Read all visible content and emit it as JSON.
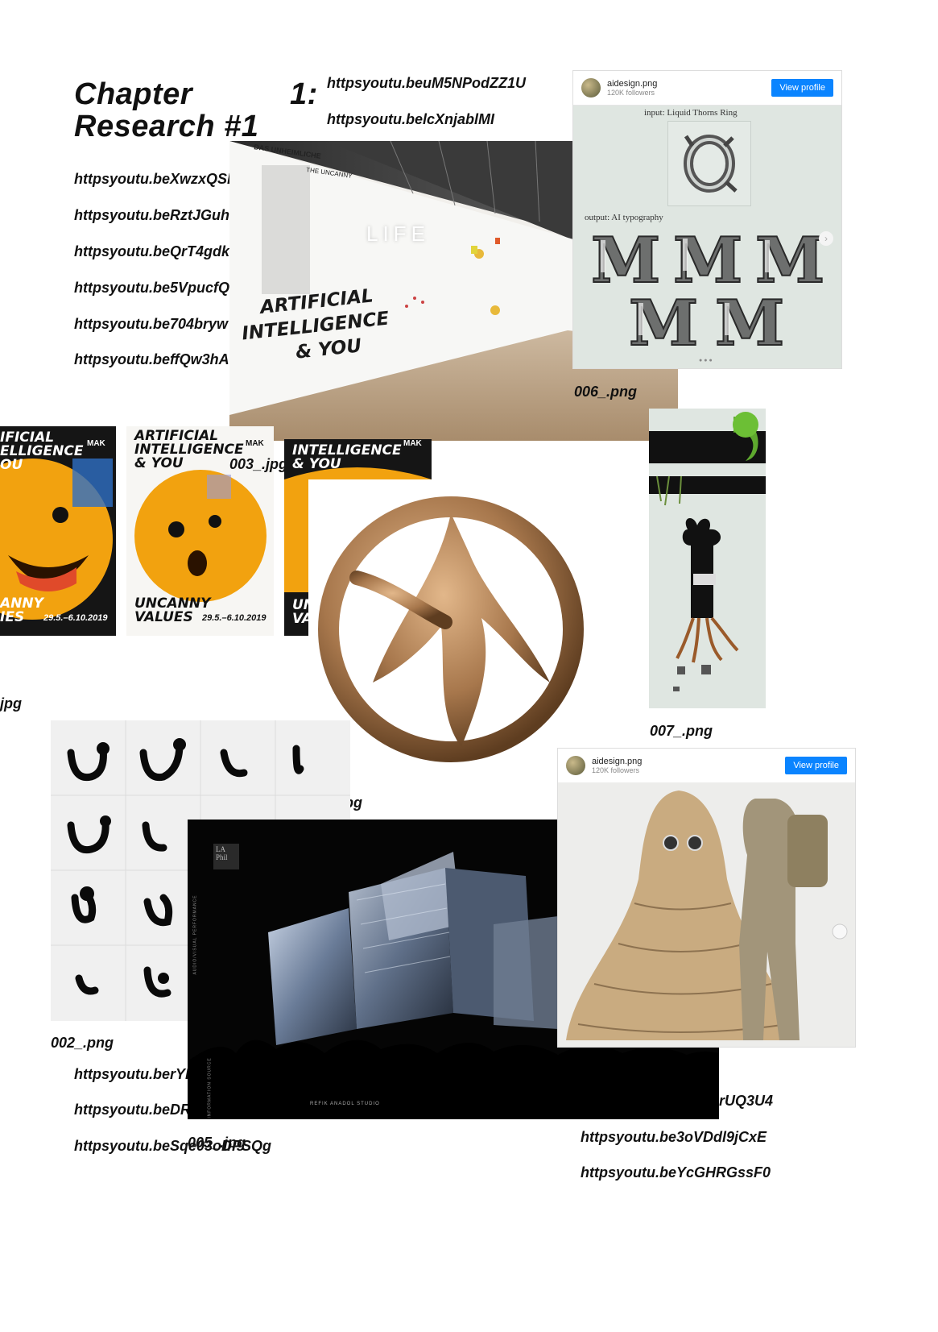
{
  "header": {
    "title_line1": "Chapter",
    "title_line2": "Research #1",
    "chapter_number": "1:"
  },
  "top_links": [
    "httpsyoutu.beuM5NPodZZ1U",
    "httpsyoutu.belcXnjablMI"
  ],
  "left_links": [
    "httpsyoutu.beXwzxQSE",
    "httpsyoutu.beRztJGuh(",
    "httpsyoutu.beQrT4gdk",
    "httpsyoutu.be5VpucfQI",
    "httpsyoutu.be704bryw",
    "httpsyoutu.beffQw3hA"
  ],
  "bottom_left_links": [
    "httpsyoutu.berYF",
    "httpsyoutu.beDR",
    "httpsyoutu.beSqe03oDPSQg"
  ],
  "bottom_right_links": [
    "rUQ3U4",
    "httpsyoutu.be3oVDdl9jCxE",
    "httpsyoutu.beYcGHRGssF0"
  ],
  "captions": {
    "c006": "006_.png",
    "c003": "003_.jpg",
    "c001": "jpg",
    "c007": "007_.png",
    "c004": "004_.jpg",
    "c002": "002_.png",
    "c005": "005_.jpg"
  },
  "exhibition": {
    "headline_1": "ARTIFICIAL",
    "headline_2": "INTELLIGENCE",
    "headline_3": "& YOU",
    "wall_title": "DAS UNHEIMLICHE",
    "wall_sub": "THE UNCANNY",
    "wall_big": "LIFE"
  },
  "insta_1": {
    "name": "aidesign.png",
    "followers": "120K followers",
    "button": "View profile",
    "input_label": "input:  Liquid Thorns Ring",
    "output_label": "output:  AI typography"
  },
  "insta_2": {
    "name": "aidesign.png",
    "followers": "120K followers",
    "button": "View profile"
  },
  "posters": {
    "p1_line1": "IFICIAL",
    "p1_line2": "ELLIGENCE",
    "p1_line3": "OU",
    "p1_bottom1": "ANNY",
    "p1_bottom2": "IES",
    "p1_date": "29.5.–6.10.2019",
    "p2_line1": "ARTIFICIAL",
    "p2_line2": "INTELLIGENCE",
    "p2_line3": "& YOU",
    "p2_bottom1": "UNCANNY",
    "p2_bottom2": "VALUES",
    "p2_date": "29.5.–6.10.2019",
    "p3_line1": "INTELLIGENCE",
    "p3_line2": "& YOU",
    "p3_bottom1": "UN",
    "p3_bottom2": "VA",
    "mak": "MAK"
  },
  "projection": {
    "logo_1": "LA",
    "logo_2": "Phil",
    "side_text": "AUDIO/VISUAL PERFORMANCE",
    "side_text_2": "INFORMATION SOURCE",
    "credit": "REFIK ANADOL STUDIO"
  },
  "colors": {
    "insta_button": "#0a84ff",
    "emoji_orange": "#f2a20f",
    "figure_bronze": "#a7774c",
    "mint_bg": "#dfe6e1"
  }
}
